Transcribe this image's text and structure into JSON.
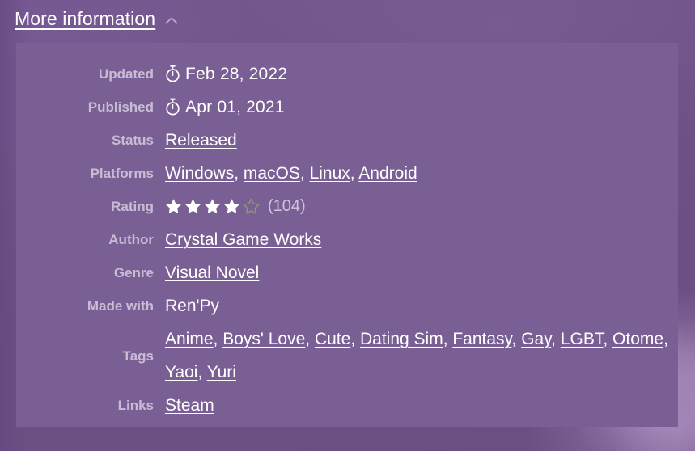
{
  "header": {
    "label": "More information",
    "toggle_icon": "chevron-up-icon"
  },
  "panel": {
    "rows": [
      {
        "key": "Updated",
        "type": "date",
        "icon": "stopwatch-icon",
        "value": "Feb 28, 2022"
      },
      {
        "key": "Published",
        "type": "date",
        "icon": "stopwatch-icon",
        "value": "Apr 01, 2021"
      },
      {
        "key": "Status",
        "type": "links",
        "values": [
          "Released"
        ]
      },
      {
        "key": "Platforms",
        "type": "links",
        "values": [
          "Windows",
          "macOS",
          "Linux",
          "Android"
        ]
      },
      {
        "key": "Rating",
        "type": "rating",
        "stars_filled": 4,
        "stars_total": 5,
        "count_label": "(104)"
      },
      {
        "key": "Author",
        "type": "links",
        "values": [
          "Crystal Game Works"
        ]
      },
      {
        "key": "Genre",
        "type": "links",
        "values": [
          "Visual Novel"
        ]
      },
      {
        "key": "Made with",
        "type": "links",
        "values": [
          "Ren'Py"
        ]
      },
      {
        "key": "Tags",
        "type": "links",
        "values": [
          "Anime",
          "Boys' Love",
          "Cute",
          "Dating Sim",
          "Fantasy",
          "Gay",
          "LGBT",
          "Otome",
          "Yaoi",
          "Yuri"
        ]
      },
      {
        "key": "Links",
        "type": "links",
        "values": [
          "Steam"
        ]
      }
    ],
    "separator": ", "
  },
  "colors": {
    "page_background": "#6d5185",
    "panel_background": "#7a5f94",
    "label_text": "#c7bcd4",
    "value_text": "#ffffff",
    "rating_count_text": "#cfc5da",
    "star_filled": "#ffffff",
    "star_empty_stroke": "#8a9a7a",
    "chevron": "#c3b4d2"
  }
}
